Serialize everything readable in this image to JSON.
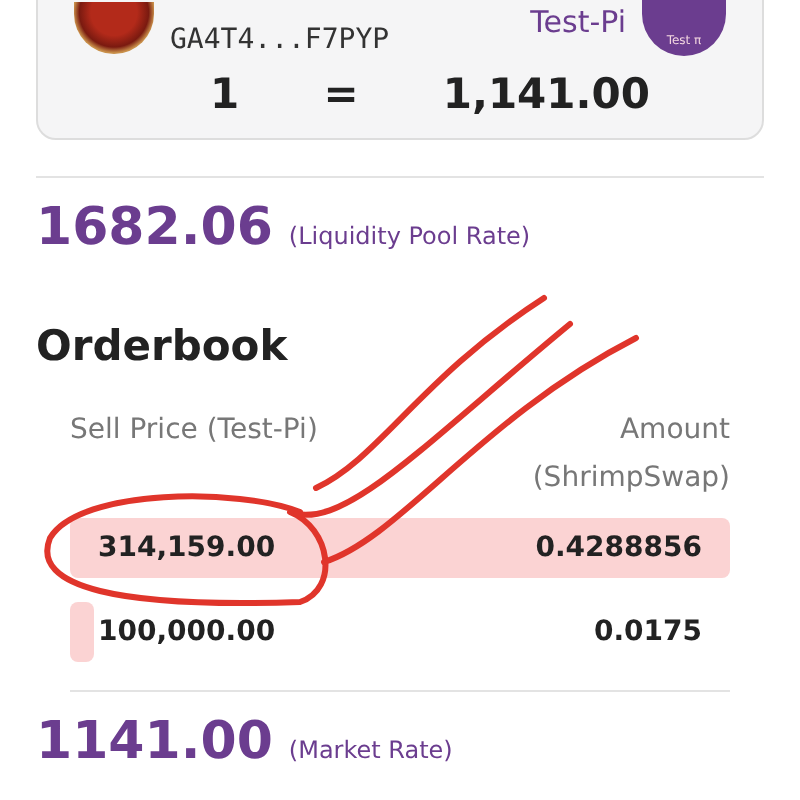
{
  "pair_card": {
    "address": "GA4T4...F7PYP",
    "asset_name": "Test-Pi",
    "asset_badge": "Test π",
    "base_amount": "1",
    "equals": "=",
    "quote_amount": "1,141.00"
  },
  "liquidity_rate": {
    "value": "1682.06",
    "label": "(Liquidity Pool Rate)"
  },
  "orderbook": {
    "title": "Orderbook",
    "columns": [
      "Sell Price (Test-Pi)",
      "Amount (ShrimpSwap)"
    ],
    "rows": [
      {
        "price": "314,159.00",
        "amount": "0.4288856",
        "kind": "wide"
      },
      {
        "price": "100,000.00",
        "amount": "0.0175",
        "kind": "narrow"
      }
    ]
  },
  "market_rate": {
    "value": "1141.00",
    "label": "(Market Rate)"
  }
}
